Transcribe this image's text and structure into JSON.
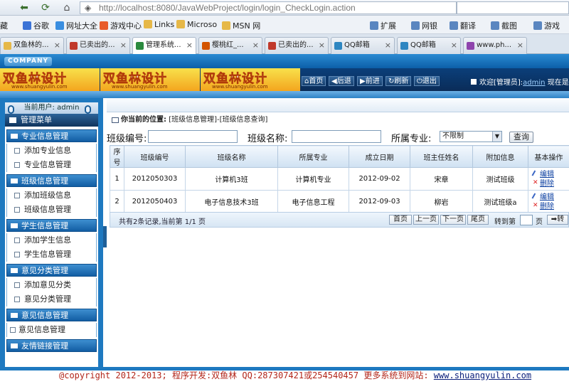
{
  "browser": {
    "url_host": "http://localhost",
    "url_rest": ":8080/JavaWebProject/login/login_CheckLogin.action",
    "favorites": [
      "藏",
      "谷歌",
      "网址大全",
      "游戏中心",
      "Links",
      "Microso",
      "MSN 网"
    ],
    "tools": [
      "扩展",
      "网银",
      "翻译",
      "截图",
      "游戏"
    ],
    "tabs": [
      "双鱼林的...",
      "已卖出的...",
      "管理系统...",
      "樱桃红_...",
      "已卖出的...",
      "QQ邮箱",
      "QQ邮箱",
      "www.ph..."
    ]
  },
  "header": {
    "company": "COMPANY",
    "logo_text": "双鱼林设计",
    "logo_sub": "www.shuangyulin.com",
    "buttons": [
      "首页",
      "后退",
      "前进",
      "刷新",
      "退出"
    ],
    "welcome_prefix": "欢迎[管理员]:",
    "welcome_user": "admin",
    "welcome_suffix": "现在是"
  },
  "sidebar": {
    "current_user": "当前用户: admin",
    "menu_title": "管理菜单",
    "groups": [
      {
        "title": "专业信息管理",
        "items": [
          "添加专业信息",
          "专业信息管理"
        ]
      },
      {
        "title": "班级信息管理",
        "items": [
          "添加班级信息",
          "班级信息管理"
        ]
      },
      {
        "title": "学生信息管理",
        "items": [
          "添加学生信息",
          "学生信息管理"
        ]
      },
      {
        "title": "意见分类管理",
        "items": [
          "添加意见分类",
          "意见分类管理"
        ]
      },
      {
        "title": "意见信息管理",
        "items": [
          "意见信息管理"
        ]
      },
      {
        "title": "友情链接管理",
        "items": []
      }
    ]
  },
  "main": {
    "location_label": "你当前的位置:",
    "location_path": "[班级信息管理]-[班级信息查询]",
    "search": {
      "class_no_label": "班级编号:",
      "class_name_label": "班级名称:",
      "major_label": "所属专业:",
      "major_value": "不限制",
      "query_button": "查询"
    },
    "table": {
      "headers": [
        "序号",
        "班级编号",
        "班级名称",
        "所属专业",
        "成立日期",
        "班主任姓名",
        "附加信息",
        "基本操作"
      ],
      "rows": [
        [
          "1",
          "2012050303",
          "计算机3班",
          "计算机专业",
          "2012-09-02",
          "宋章",
          "测试班级"
        ],
        [
          "2",
          "2012050403",
          "电子信息技术3班",
          "电子信息工程",
          "2012-09-03",
          "柳岩",
          "测试班级a"
        ]
      ],
      "edit_label": "编辑",
      "delete_label": "删除"
    },
    "pager": {
      "info": "共有2条记录,当前第 1/1 页",
      "first": "首页",
      "prev": "上一页",
      "next": "下一页",
      "last": "尾页",
      "goto_label": "转到第",
      "page_unit": "页",
      "goto_button": "➡转"
    }
  },
  "footer": {
    "copyright": "@copyright 2012-2013; 程序开发:双鱼林  QQ:287307421或254540457  更多系统到网站: ",
    "site": "www.shuangyulin.com"
  }
}
